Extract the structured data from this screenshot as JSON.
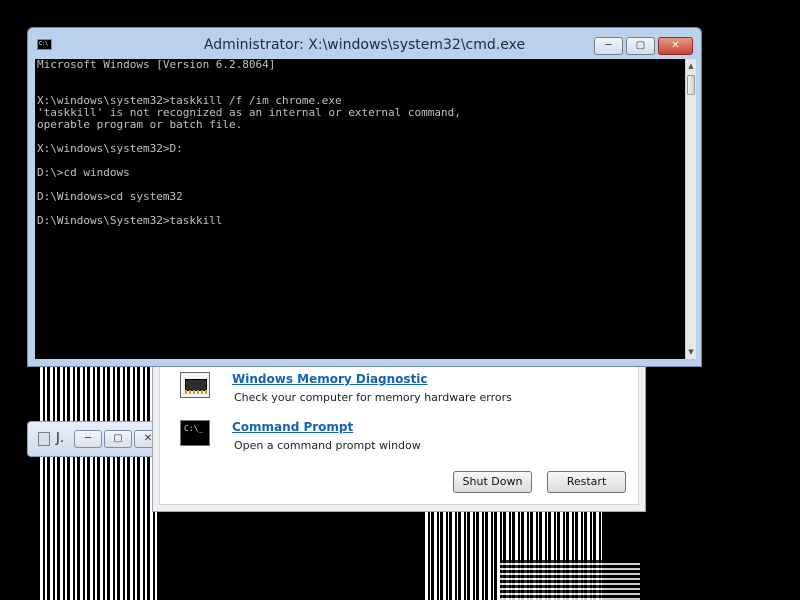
{
  "cmd_window": {
    "title": "Administrator: X:\\windows\\system32\\cmd.exe",
    "icon_label": "C:\\",
    "buttons": {
      "minimize": "─",
      "maximize": "▢",
      "close": "✕"
    },
    "console_lines": [
      "Microsoft Windows [Version 6.2.8064]",
      "",
      "",
      "X:\\windows\\system32>taskkill /f /im chrome.exe",
      "'taskkill' is not recognized as an internal or external command,",
      "operable program or batch file.",
      "",
      "X:\\windows\\system32>D:",
      "",
      "D:\\>cd windows",
      "",
      "D:\\Windows>cd system32",
      "",
      "D:\\Windows\\System32>taskkill"
    ],
    "scrollbar": {
      "up": "▲",
      "down": "▼"
    }
  },
  "mini_window": {
    "title": "J.",
    "buttons": {
      "minimize": "─",
      "maximize": "▢",
      "close": "✕"
    }
  },
  "options_panel": {
    "options": [
      {
        "title": "Windows Memory Diagnostic",
        "description": "Check your computer for memory hardware errors",
        "icon": "memory-chip-icon"
      },
      {
        "title": "Command Prompt",
        "description": "Open a command prompt window",
        "icon": "command-prompt-icon",
        "icon_text": "C:\\_"
      }
    ],
    "buttons": {
      "shutdown": "Shut Down",
      "restart": "Restart"
    }
  }
}
